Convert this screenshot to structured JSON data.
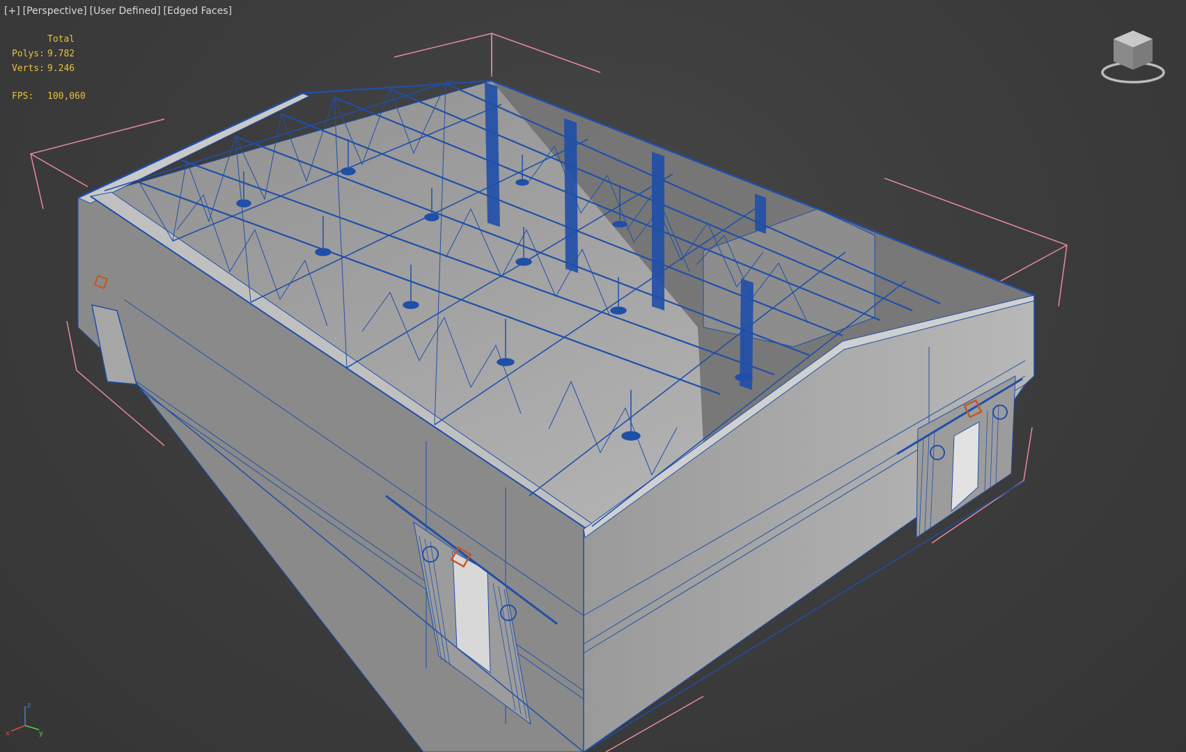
{
  "viewport": {
    "labels": [
      "[+]",
      "[Perspective]",
      "[User Defined]",
      "[Edged Faces]"
    ]
  },
  "stats": {
    "header": "Total",
    "polys_label": "Polys:",
    "polys_value": "9.782",
    "verts_label": "Verts:",
    "verts_value": "9.246",
    "fps_label": "FPS:",
    "fps_value": "100,060"
  },
  "axis": {
    "z": "z",
    "x": "x",
    "y": "y"
  },
  "colors": {
    "background": "#3d3d3d",
    "wire": "#1f4fa8",
    "label": "#d9d9d9",
    "stats": "#e8c23a",
    "bbox": "#e98aa0",
    "selection": "#c8541e"
  }
}
